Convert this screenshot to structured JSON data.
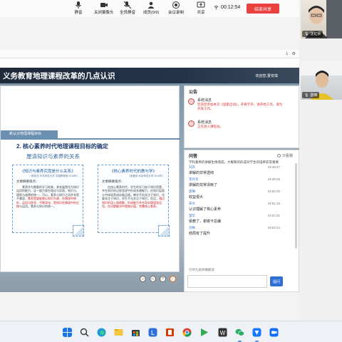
{
  "toolbar": {
    "mute_label": "静音",
    "camera_label": "关闭摄像头",
    "mute_all_label": "全员静音",
    "members_label": "成员(9/9)",
    "record_label": "会议录制",
    "share_label": "共享",
    "timer": "00:12:54",
    "end_share_label": "结束共享"
  },
  "participants": [
    {
      "name": "沈虹祯"
    },
    {
      "name": "邵琳"
    }
  ],
  "page": {
    "title": "义务教育地理课程改革的几点认识",
    "welcome": "欢迎您,曹安琪"
  },
  "slide": {
    "tag": "新认识地理课程目标",
    "heading": "2. 核心素养时代地理课程目标的确定",
    "subheading": "厘清知识与素养的关系",
    "card_left": {
      "title": "《知识与素养究竟是什么关系》",
      "source": "（杨向东 华东师范大学 中国教育报 2018年）",
      "label": "文章摘要观点：",
      "body": "素养作为需要的学习结果，其发展是作为知识运用的能力。这一能力意在理论与实践、知识与、理智与道德的统一，可以，素养与知识之间并非是不兼容，",
      "emphasis": "素养是要能够以知识为源，在情境中辨析，运用与探寻，不断深化，是知识在情境中的迁移",
      "tail": "与运用。素养与知识的统一。"
    },
    "card_right": {
      "title": "《核心素养时代的教与学》",
      "source": "（吴爱萍 北京师范大学 2019年）",
      "label": "文章摘要观点：",
      "body": "在核心素养时代，学生的学习始于知识积累，并在知识的过程里逐中形成关键能力，在知识层面义中体现养成必备品格。",
      "body2": "教学不仅关注于知识，也要关注于知识，学生不光关注于知识，而且，",
      "emphasis": "通过知识的深入和理解，形成能力并在现实情境里运用，在问题解决中提炼价值，完整核心素养。"
    }
  },
  "controls": [
    "◁",
    "▷",
    "?",
    "ⓘ"
  ],
  "notice": {
    "title": "公告",
    "items": [
      {
        "head": "系统消息",
        "text": "欢迎您参加本次《国家启动》，开要学开，请开始工作，请为开发工作。"
      },
      {
        "head": "系统消息",
        "text": "正在进入课程总。"
      }
    ]
  },
  "qa": {
    "title": "问答",
    "sort_label": "只看我",
    "first_message": "学科素养的讲解生情境成，大概和的形成对学生的培养非常重要",
    "items": [
      {
        "name": "刘庆",
        "time": "19:48:47",
        "msg": "讲解的非常透彻"
      },
      {
        "name": "李丹华",
        "time": "19:49:25",
        "msg": "讲解的非常清晰了"
      },
      {
        "name": "邵琳",
        "time": "19:50:20",
        "msg": "收益很大"
      },
      {
        "name": "宋文",
        "time": "19:51:16",
        "msg": "认识理解了核心素养"
      },
      {
        "name": "邹华",
        "time": "19:51:51",
        "msg": "受教了，谢谢卡总编"
      },
      {
        "name": "刘梅",
        "time": "19:53:14",
        "msg": "结局有了提升"
      }
    ],
    "hint": "引导九段阅做解读",
    "input_placeholder": "",
    "send_label": "提问"
  },
  "colors": {
    "accent": "#2f6fd6",
    "end_share": "#e94040",
    "notice_red": "#d93636",
    "slide_blue": "#1c3d6e"
  }
}
